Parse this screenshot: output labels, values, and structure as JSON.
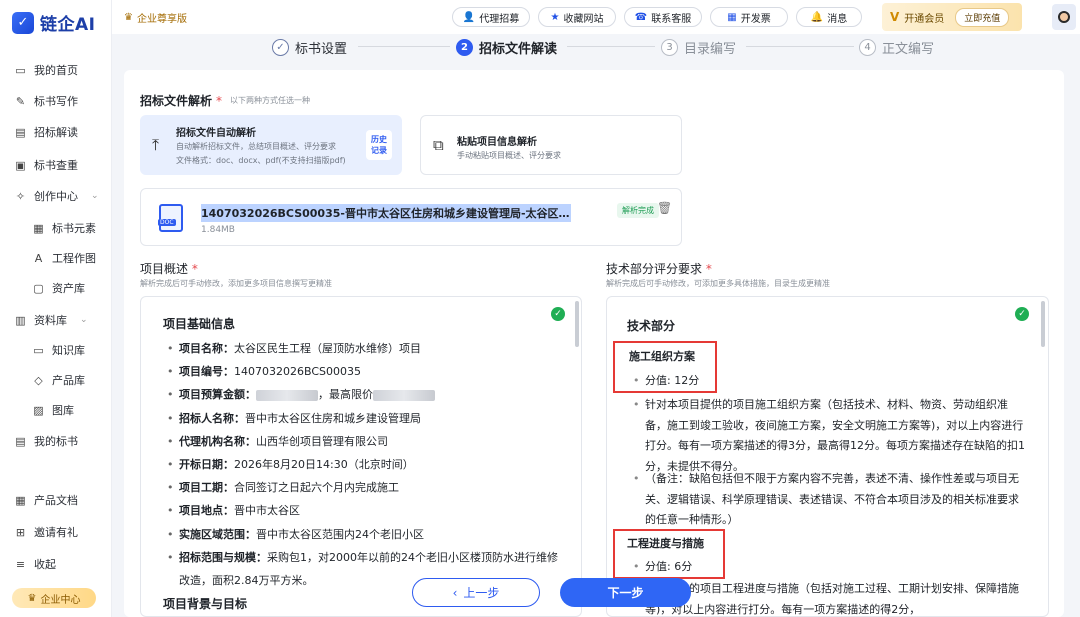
{
  "brand": {
    "logo_glyph": "✓",
    "name": "链企AI"
  },
  "sidebar": {
    "items": [
      {
        "label": "我的首页",
        "icon": "▭"
      },
      {
        "label": "标书写作",
        "icon": "✎"
      },
      {
        "label": "招标解读",
        "icon": "▤"
      },
      {
        "label": "标书查重",
        "icon": "▣"
      },
      {
        "label": "创作中心",
        "icon": "✧",
        "chev": "⌄"
      },
      {
        "label": "标书元素",
        "icon": "▦"
      },
      {
        "label": "工程作图",
        "icon": "A"
      },
      {
        "label": "资产库",
        "icon": "▢"
      },
      {
        "label": "资料库",
        "icon": "▥",
        "chev": "⌄"
      },
      {
        "label": "知识库",
        "icon": "▭"
      },
      {
        "label": "产品库",
        "icon": "◇"
      },
      {
        "label": "图库",
        "icon": "▨"
      },
      {
        "label": "我的标书",
        "icon": "▤"
      },
      {
        "label": "产品文档",
        "icon": "▦"
      },
      {
        "label": "邀请有礼",
        "icon": "⊞"
      },
      {
        "label": "收起",
        "icon": "≡"
      }
    ],
    "enterprise_center": "企业中心"
  },
  "topbar": {
    "edition": "企业尊享版",
    "buttons": {
      "agent": "代理招募",
      "favorite": "收藏网站",
      "support": "联系客服",
      "invoice": "开发票",
      "message": "消息"
    },
    "vip": {
      "logo": "V",
      "label": "开通会员",
      "recharge": "立即充值"
    }
  },
  "steps": [
    {
      "num": "✓",
      "label": "标书设置"
    },
    {
      "num": "2",
      "label": "招标文件解读"
    },
    {
      "num": "3",
      "label": "目录编写"
    },
    {
      "num": "4",
      "label": "正文编写"
    }
  ],
  "parse": {
    "title": "招标文件解析",
    "required": "*",
    "hint": "以下两种方式任选一种",
    "auto": {
      "title": "招标文件自动解析",
      "desc": "自动解析招标文件，总结项目概述、评分要求",
      "formats": "文件格式：doc、docx、pdf(不支持扫描版pdf)",
      "history": "历史记录",
      "upload_glyph": "⤒"
    },
    "paste": {
      "title": "粘贴项目信息解析",
      "desc": "手动粘贴项目概述、评分要求",
      "glyph": "⧉"
    }
  },
  "file": {
    "name": "1407032026BCS00035-晋中市太谷区住房和城乡建设管理局-太谷区民...",
    "size": "1.84MB",
    "status": "解析完成",
    "type_tag": "DOC",
    "trash_glyph": "🗑"
  },
  "overview": {
    "label": "项目概述",
    "hint": "解析完成后可手动修改，添加更多项目信息撰写更精准",
    "heading": "项目基础信息",
    "items": [
      {
        "k": "项目名称：",
        "v": "太谷区民生工程（屋顶防水维修）项目"
      },
      {
        "k": "项目编号：",
        "v": "1407032026BCS00035"
      },
      {
        "k": "项目预算金额：",
        "v": "，最高限价",
        "redacted": true
      },
      {
        "k": "招标人名称：",
        "v": "晋中市太谷区住房和城乡建设管理局"
      },
      {
        "k": "代理机构名称：",
        "v": "山西华创项目管理有限公司"
      },
      {
        "k": "开标日期：",
        "v": "2026年8月20日14:30（北京时间）"
      },
      {
        "k": "项目工期：",
        "v": "合同签订之日起六个月内完成施工"
      },
      {
        "k": "项目地点：",
        "v": "晋中市太谷区"
      },
      {
        "k": "实施区域范围：",
        "v": "晋中市太谷区范围内24个老旧小区"
      },
      {
        "k": "招标范围与规模：",
        "v": "采购包1，对2000年以前的24个老旧小区楼顶防水进行维修改造，面积2.84万平方米。"
      }
    ],
    "next_heading": "项目背景与目标"
  },
  "technical": {
    "label": "技术部分评分要求",
    "hint": "解析完成后可手动修改，可添加更多具体措施，目录生成更精准",
    "heading": "技术部分",
    "s1": {
      "title": "施工组织方案",
      "score": "分值: 12分",
      "p1": "针对本项目提供的项目施工组织方案（包括技术、材料、物资、劳动组织准备，施工到竣工验收，夜间施工方案，安全文明施工方案等)，对以上内容进行打分。每有一项方案描述的得3分，最高得12分。每项方案描述存在缺陷的扣1分，未提供不得分。",
      "p2": "（备注：缺陷包括但不限于方案内容不完善，表述不清、操作性差或与项目无关、逻辑错误、科学原理错误、表述错误、不符合本项目涉及的相关标准要求的任意一种情形。）"
    },
    "s2": {
      "title": "工程进度与措施",
      "score": "分值: 6分",
      "p1": "项目制定的项目工程进度与措施（包括对施工过程、工期计划安排、保障措施等)，对以上内容进行打分。每有一项方案描述的得2分，"
    }
  },
  "actions": {
    "prev": "上一步",
    "prev_glyph": "‹",
    "next": "下一步"
  }
}
